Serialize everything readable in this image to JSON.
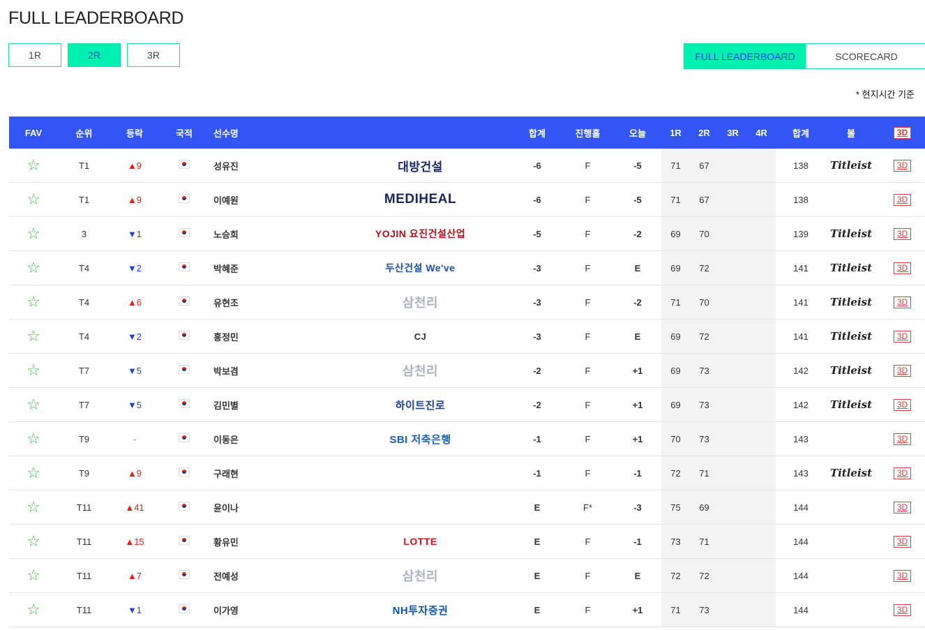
{
  "title": "FULL LEADERBOARD",
  "round_tabs": [
    {
      "label": "1R",
      "active": false
    },
    {
      "label": "2R",
      "active": true
    },
    {
      "label": "3R",
      "active": false
    }
  ],
  "view_tabs": [
    {
      "label": "FULL LEADERBOARD",
      "active": true
    },
    {
      "label": "SCORECARD",
      "active": false
    }
  ],
  "local_time_note": "* 현지시간 기준",
  "columns": {
    "fav": "FAV",
    "rank": "순위",
    "move": "등락",
    "nation": "국적",
    "player": "선수명",
    "total": "합계",
    "hole": "진행홀",
    "today": "오늘",
    "r1": "1R",
    "r2": "2R",
    "r3": "3R",
    "r4": "4R",
    "sum": "합계",
    "ball": "볼",
    "view3d": "3D"
  },
  "rows": [
    {
      "rank": "T1",
      "move": "▲9",
      "dir": "up",
      "player": "성유진",
      "sponsor": "대방건설",
      "total": "-6",
      "hole": "F",
      "today": "-5",
      "r1": "71",
      "r2": "67",
      "sum": "138",
      "ball": "Titleist",
      "btn": "3D"
    },
    {
      "rank": "T1",
      "move": "▲9",
      "dir": "up",
      "player": "이예원",
      "sponsor": "MEDIHEAL",
      "total": "-6",
      "hole": "F",
      "today": "-5",
      "r1": "71",
      "r2": "67",
      "sum": "138",
      "ball": "",
      "btn": "3D"
    },
    {
      "rank": "3",
      "move": "▼1",
      "dir": "down",
      "player": "노승희",
      "sponsor": "YOJIN 요진건설산업",
      "total": "-5",
      "hole": "F",
      "today": "-2",
      "r1": "69",
      "r2": "70",
      "sum": "139",
      "ball": "Titleist",
      "btn": "3D"
    },
    {
      "rank": "T4",
      "move": "▼2",
      "dir": "down",
      "player": "박혜준",
      "sponsor": "두산건설 We've",
      "total": "-3",
      "hole": "F",
      "today": "E",
      "r1": "69",
      "r2": "72",
      "sum": "141",
      "ball": "Titleist",
      "btn": "3D"
    },
    {
      "rank": "T4",
      "move": "▲6",
      "dir": "up",
      "player": "유현조",
      "sponsor": "삼천리",
      "total": "-3",
      "hole": "F",
      "today": "-2",
      "r1": "71",
      "r2": "70",
      "sum": "141",
      "ball": "Titleist",
      "btn": "3D"
    },
    {
      "rank": "T4",
      "move": "▼2",
      "dir": "down",
      "player": "홍정민",
      "sponsor": "CJ",
      "total": "-3",
      "hole": "F",
      "today": "E",
      "r1": "69",
      "r2": "72",
      "sum": "141",
      "ball": "Titleist",
      "btn": "3D"
    },
    {
      "rank": "T7",
      "move": "▼5",
      "dir": "down",
      "player": "박보겸",
      "sponsor": "삼천리",
      "total": "-2",
      "hole": "F",
      "today": "+1",
      "r1": "69",
      "r2": "73",
      "sum": "142",
      "ball": "Titleist",
      "btn": "3D"
    },
    {
      "rank": "T7",
      "move": "▼5",
      "dir": "down",
      "player": "김민별",
      "sponsor": "하이트진로",
      "total": "-2",
      "hole": "F",
      "today": "+1",
      "r1": "69",
      "r2": "73",
      "sum": "142",
      "ball": "Titleist",
      "btn": "3D"
    },
    {
      "rank": "T9",
      "move": "-",
      "dir": "none",
      "player": "이동은",
      "sponsor": "SBI 저축은행",
      "total": "-1",
      "hole": "F",
      "today": "+1",
      "r1": "70",
      "r2": "73",
      "sum": "143",
      "ball": "",
      "btn": "3D"
    },
    {
      "rank": "T9",
      "move": "▲9",
      "dir": "up",
      "player": "구래현",
      "sponsor": "",
      "total": "-1",
      "hole": "F",
      "today": "-1",
      "r1": "72",
      "r2": "71",
      "sum": "143",
      "ball": "Titleist",
      "btn": "3D"
    },
    {
      "rank": "T11",
      "move": "▲41",
      "dir": "up",
      "player": "윤이나",
      "sponsor": "",
      "total": "E",
      "hole": "F*",
      "today": "-3",
      "r1": "75",
      "r2": "69",
      "sum": "144",
      "ball": "",
      "btn": "3D"
    },
    {
      "rank": "T11",
      "move": "▲15",
      "dir": "up",
      "player": "황유민",
      "sponsor": "LOTTE",
      "total": "E",
      "hole": "F",
      "today": "-1",
      "r1": "73",
      "r2": "71",
      "sum": "144",
      "ball": "",
      "btn": "3D"
    },
    {
      "rank": "T11",
      "move": "▲7",
      "dir": "up",
      "player": "전예성",
      "sponsor": "삼천리",
      "total": "E",
      "hole": "F",
      "today": "E",
      "r1": "72",
      "r2": "72",
      "sum": "144",
      "ball": "",
      "btn": "3D"
    },
    {
      "rank": "T11",
      "move": "▼1",
      "dir": "down",
      "player": "이가영",
      "sponsor": "NH투자증권",
      "total": "E",
      "hole": "F",
      "today": "+1",
      "r1": "71",
      "r2": "73",
      "sum": "144",
      "ball": "",
      "btn": "3D"
    }
  ],
  "colors": {
    "header": "#3355f3",
    "accent": "#00f0b0",
    "up": "#e0201c",
    "down": "#1f3fd8",
    "negative": "#f06a25",
    "positive": "#1f9fd8"
  },
  "icons": {
    "fav": "star-outline-icon",
    "nation": "korea-flag-icon"
  }
}
